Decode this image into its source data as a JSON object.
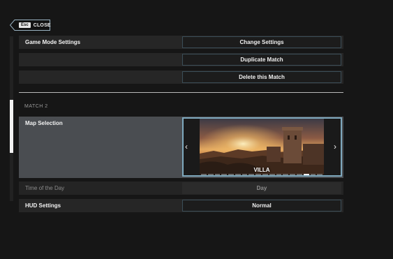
{
  "close": {
    "key": "Esc",
    "label": "CLOSE"
  },
  "rows": {
    "game_mode": {
      "label": "Game Mode Settings",
      "button": "Change Settings"
    },
    "duplicate": {
      "button": "Duplicate Match"
    },
    "delete": {
      "button": "Delete this Match"
    }
  },
  "section": {
    "title": "MATCH 2"
  },
  "map": {
    "label": "Map Selection",
    "name": "VILLA",
    "dots_total": 18,
    "active_index": 15,
    "prev_icon": "chevron-left-icon",
    "next_icon": "chevron-right-icon"
  },
  "time_of_day": {
    "label": "Time of the Day",
    "value": "Day",
    "enabled": false
  },
  "hud": {
    "label": "HUD Settings",
    "value": "Normal"
  },
  "colors": {
    "background": "#161616",
    "row": "#262626",
    "selected_row": "#4a4d51",
    "accent_border": "#7ea8bd",
    "button_border": "#3b4d57"
  }
}
